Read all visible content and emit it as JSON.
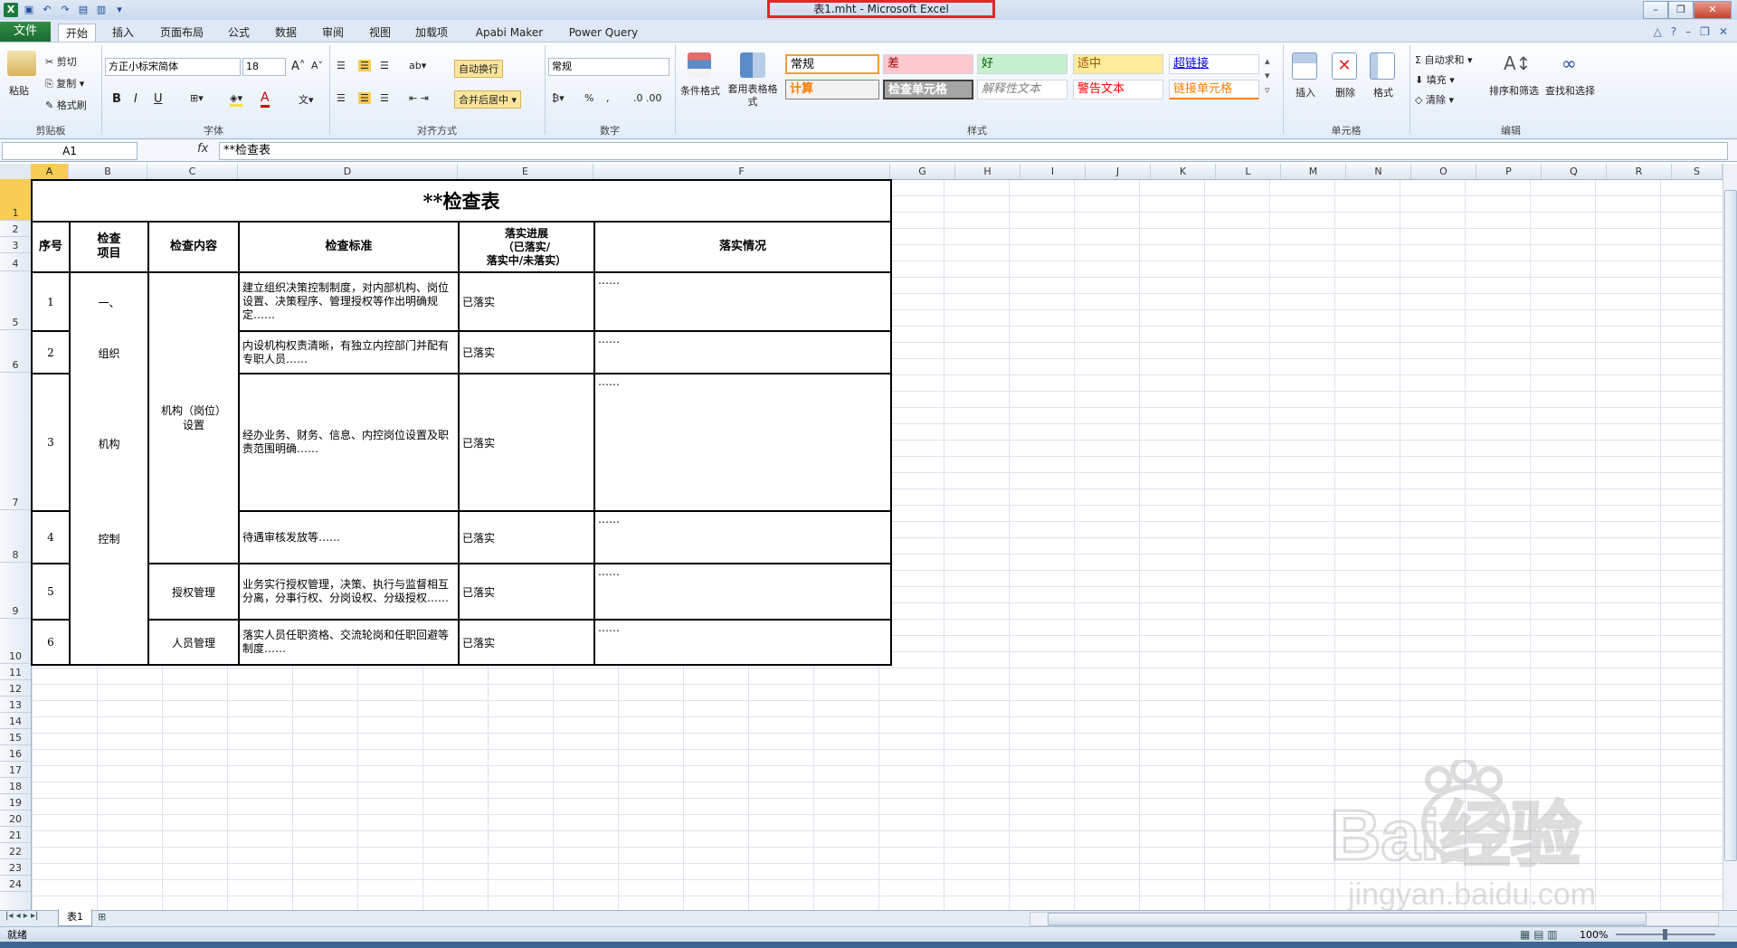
{
  "window": {
    "title": "表1.mht - Microsoft Excel"
  },
  "tabs": [
    "文件",
    "开始",
    "插入",
    "页面布局",
    "公式",
    "数据",
    "审阅",
    "视图",
    "加载项",
    "Apabi Maker",
    "Power Query"
  ],
  "ribbon": {
    "clipboard": {
      "paste": "粘贴",
      "cut": "剪切",
      "copy": "复制",
      "format_painter": "格式刷",
      "label": "剪贴板"
    },
    "font": {
      "name": "方正小标宋简体",
      "size": "18",
      "bold": "B",
      "italic": "I",
      "underline": "U",
      "label": "字体"
    },
    "alignment": {
      "wrap": "自动换行",
      "merge": "合并后居中",
      "label": "对齐方式"
    },
    "number": {
      "format": "常规",
      "percent": "%",
      "comma": ",",
      "label": "数字"
    },
    "styles": {
      "conditional": "条件格式",
      "table_format": "套用表格格式",
      "cells": [
        "常规",
        "差",
        "好",
        "适中",
        "超链接",
        "计算",
        "检查单元格",
        "解释性文本",
        "警告文本",
        "链接单元格"
      ],
      "label": "样式"
    },
    "cells_group": {
      "insert": "插入",
      "delete": "删除",
      "format": "格式",
      "label": "单元格"
    },
    "editing": {
      "autosum": "自动求和",
      "fill": "填充",
      "clear": "清除",
      "sort": "排序和筛选",
      "find": "查找和选择",
      "label": "编辑"
    }
  },
  "formula_bar": {
    "name_box": "A1",
    "fx": "fx",
    "content": "**检查表"
  },
  "columns": [
    "A",
    "B",
    "C",
    "D",
    "E",
    "F",
    "G",
    "H",
    "I",
    "J",
    "K",
    "L",
    "M",
    "N",
    "O",
    "P",
    "Q",
    "R",
    "S"
  ],
  "rows": [
    "1",
    "2",
    "3",
    "4",
    "5",
    "6",
    "7",
    "8",
    "9",
    "10",
    "11",
    "12",
    "13",
    "14",
    "15",
    "16",
    "17",
    "18",
    "19",
    "20",
    "21",
    "22",
    "23",
    "24"
  ],
  "table": {
    "title": "**检查表",
    "headers": {
      "seq": "序号",
      "item": "检查\n项目",
      "content": "检查内容",
      "standard": "检查标准",
      "progress": "落实进展\n（已落实/\n落实中/未落实）",
      "status": "落实情况"
    },
    "item_labels": {
      "part1": "一、",
      "part2": "组织",
      "part3": "机构",
      "part4": "控制"
    },
    "content_labels": {
      "org": "机构（岗位）\n设置",
      "auth": "授权管理",
      "staff": "人员管理"
    },
    "rows": [
      {
        "seq": "1",
        "standard": "建立组织决策控制制度，对内部机构、岗位设置、决策程序、管理授权等作出明确规定……",
        "progress": "已落实",
        "status": "……"
      },
      {
        "seq": "2",
        "standard": "内设机构权责清晰，有独立内控部门并配有专职人员……",
        "progress": "已落实",
        "status": "……"
      },
      {
        "seq": "3",
        "standard": "经办业务、财务、信息、内控岗位设置及职责范围明确……",
        "progress": "已落实",
        "status": "……"
      },
      {
        "seq": "4",
        "standard": "待遇审核发放等……",
        "progress": "已落实",
        "status": "……"
      },
      {
        "seq": "5",
        "standard": "业务实行授权管理，决策、执行与监督相互分离，分事行权、分岗设权、分级授权……",
        "progress": "已落实",
        "status": "……"
      },
      {
        "seq": "6",
        "standard": "落实人员任职资格、交流轮岗和任职回避等制度……",
        "progress": "已落实",
        "status": "……"
      }
    ]
  },
  "sheet": {
    "tab": "表1"
  },
  "status": {
    "ready": "就绪",
    "zoom": "100%"
  },
  "watermark": {
    "text": "Bai经验",
    "sub": "jingyan.baidu.com"
  },
  "colors": {
    "file_tab": "#1c6b30",
    "selection": "#f7cd55",
    "highlight": "#e3262a"
  }
}
